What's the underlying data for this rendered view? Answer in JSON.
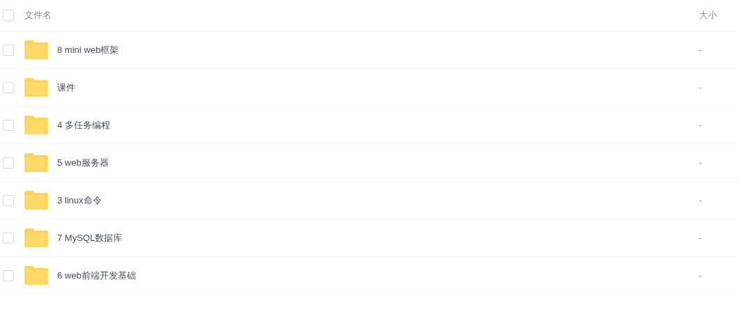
{
  "table": {
    "header_checked": false,
    "columns": [
      "文件名",
      "大小"
    ],
    "rows": [
      {
        "name": "8 mini web框架",
        "size": "-",
        "checked": false
      },
      {
        "name": "课件",
        "size": "-",
        "checked": false
      },
      {
        "name": "4 多任务编程",
        "size": "-",
        "checked": false
      },
      {
        "name": "5 web服务器",
        "size": "-",
        "checked": false
      },
      {
        "name": "3 linux命令",
        "size": "-",
        "checked": false
      },
      {
        "name": "7 MySQL数据库",
        "size": "-",
        "checked": false
      },
      {
        "name": "6 web前端开发基础",
        "size": "-",
        "checked": false
      }
    ]
  }
}
